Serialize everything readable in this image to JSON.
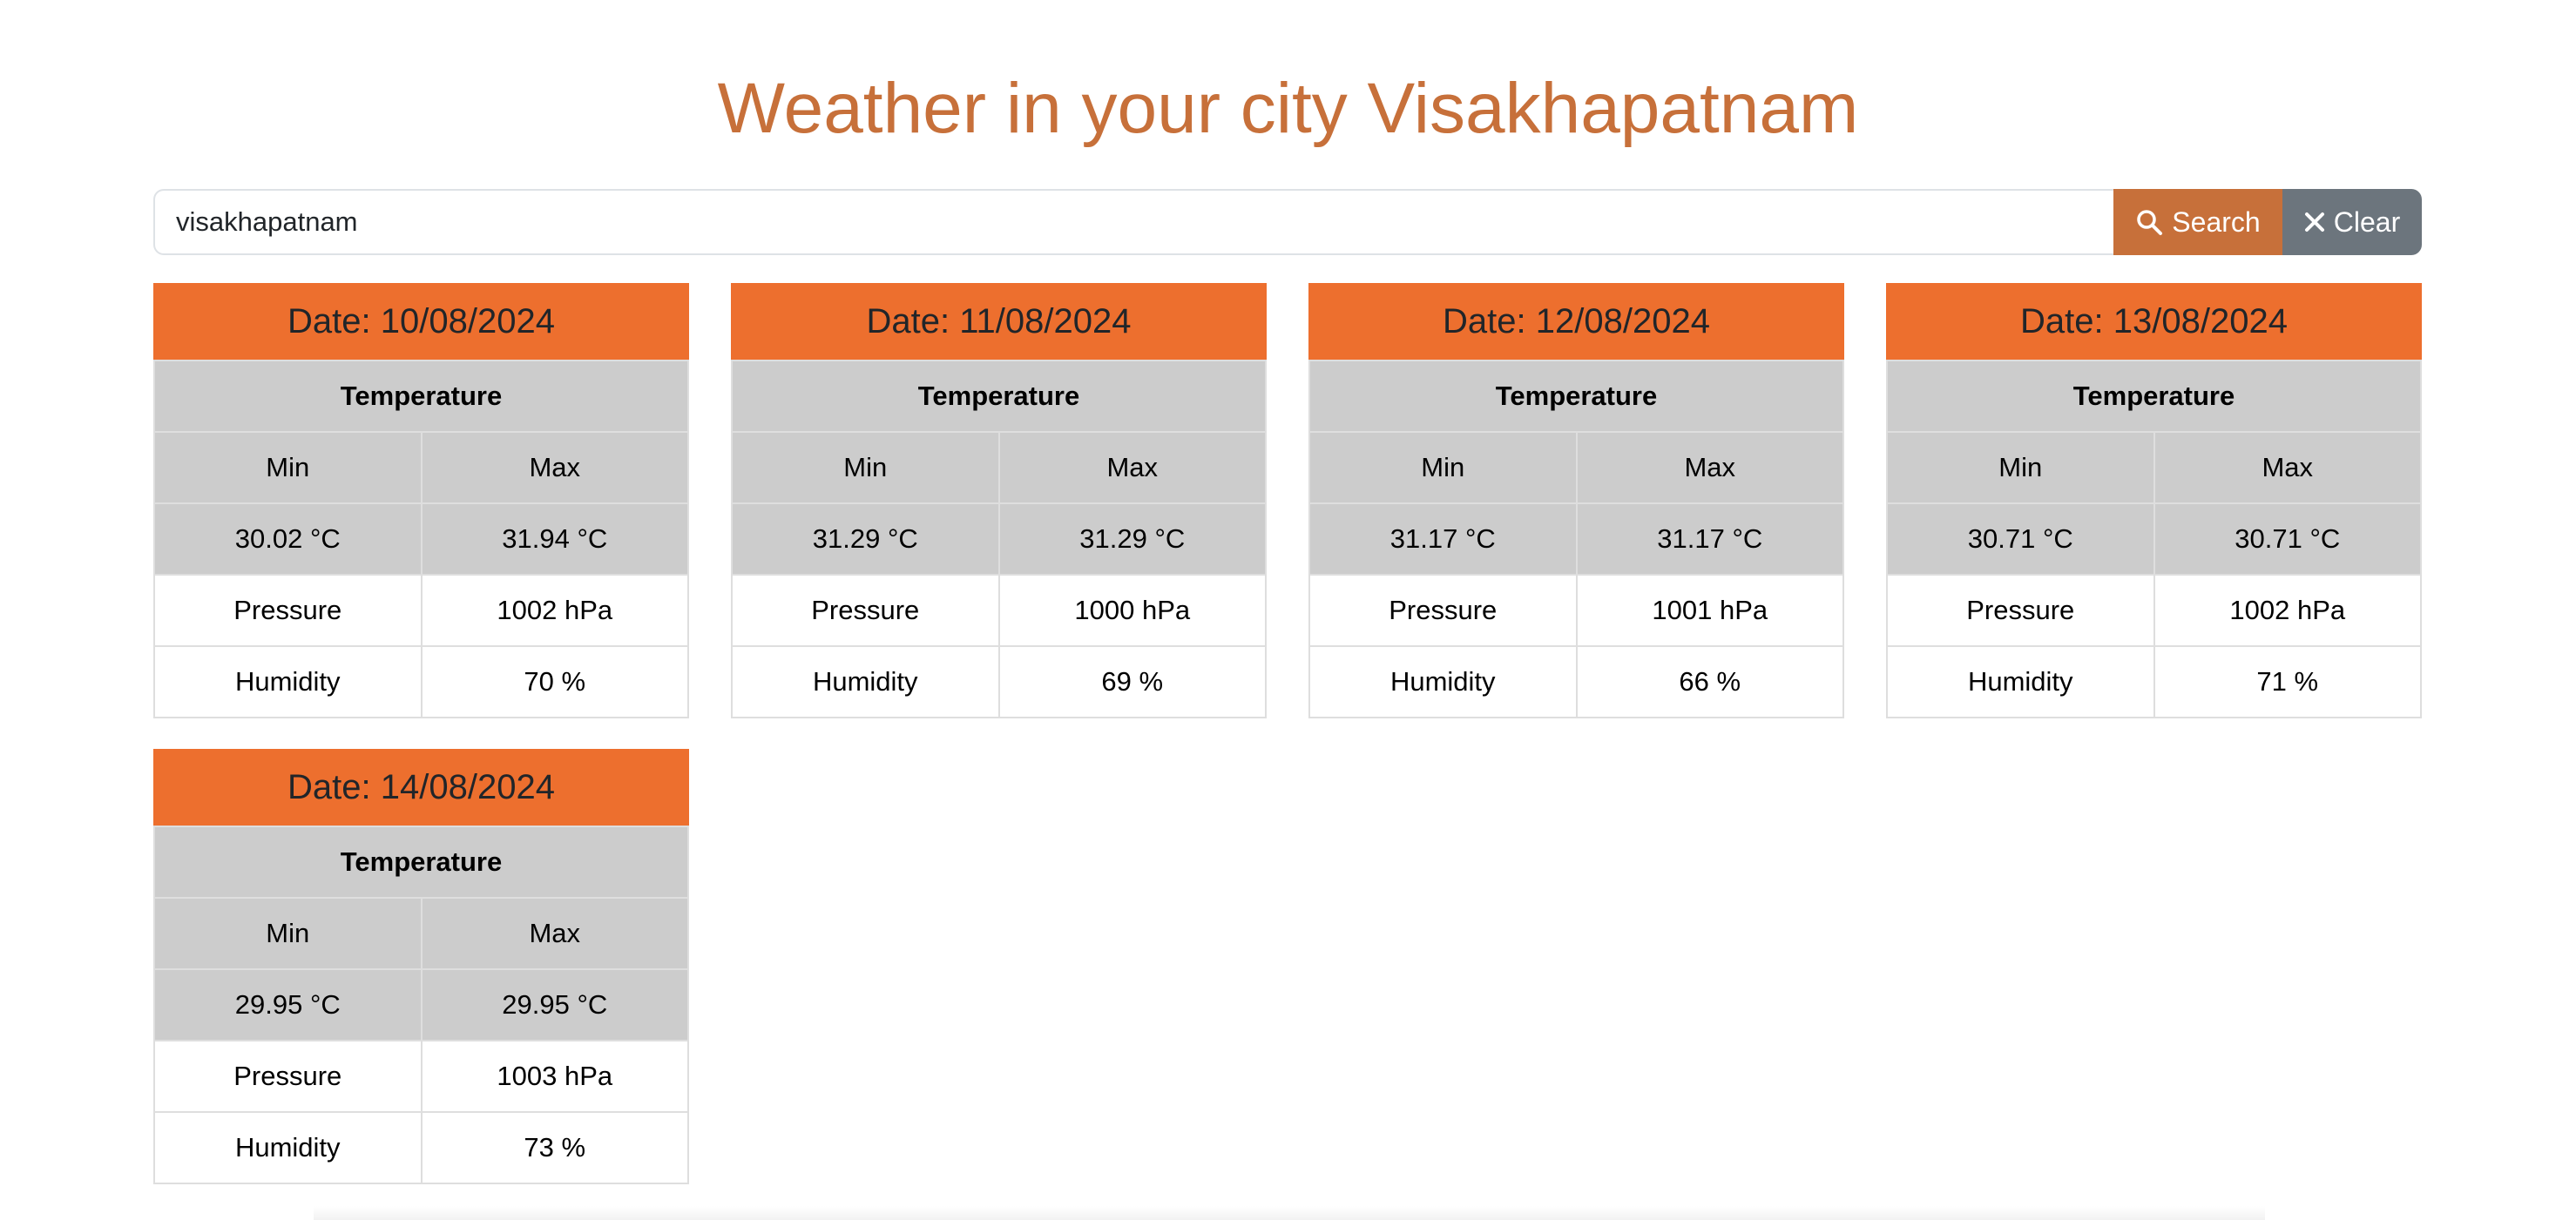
{
  "title": "Weather in your city Visakhapatnam",
  "search": {
    "value": "visakhapatnam",
    "search_label": "Search",
    "clear_label": "Clear",
    "search_icon": "search-icon",
    "clear_icon": "close-icon"
  },
  "colors": {
    "accent": "#c7703a",
    "card_header": "#ed6f2e",
    "clear_button": "#6c757d",
    "table_grey": "#cccccc"
  },
  "forecast": [
    {
      "date": "Date: 10/08/2024",
      "temperature_label": "Temperature",
      "min_label": "Min",
      "max_label": "Max",
      "min": "30.02 °C",
      "max": "31.94 °C",
      "pressure_label": "Pressure",
      "pressure": "1002 hPa",
      "humidity_label": "Humidity",
      "humidity": "70 %"
    },
    {
      "date": "Date: 11/08/2024",
      "temperature_label": "Temperature",
      "min_label": "Min",
      "max_label": "Max",
      "min": "31.29 °C",
      "max": "31.29 °C",
      "pressure_label": "Pressure",
      "pressure": "1000 hPa",
      "humidity_label": "Humidity",
      "humidity": "69 %"
    },
    {
      "date": "Date: 12/08/2024",
      "temperature_label": "Temperature",
      "min_label": "Min",
      "max_label": "Max",
      "min": "31.17 °C",
      "max": "31.17 °C",
      "pressure_label": "Pressure",
      "pressure": "1001 hPa",
      "humidity_label": "Humidity",
      "humidity": "66 %"
    },
    {
      "date": "Date: 13/08/2024",
      "temperature_label": "Temperature",
      "min_label": "Min",
      "max_label": "Max",
      "min": "30.71 °C",
      "max": "30.71 °C",
      "pressure_label": "Pressure",
      "pressure": "1002 hPa",
      "humidity_label": "Humidity",
      "humidity": "71 %"
    },
    {
      "date": "Date: 14/08/2024",
      "temperature_label": "Temperature",
      "min_label": "Min",
      "max_label": "Max",
      "min": "29.95 °C",
      "max": "29.95 °C",
      "pressure_label": "Pressure",
      "pressure": "1003 hPa",
      "humidity_label": "Humidity",
      "humidity": "73 %"
    }
  ]
}
